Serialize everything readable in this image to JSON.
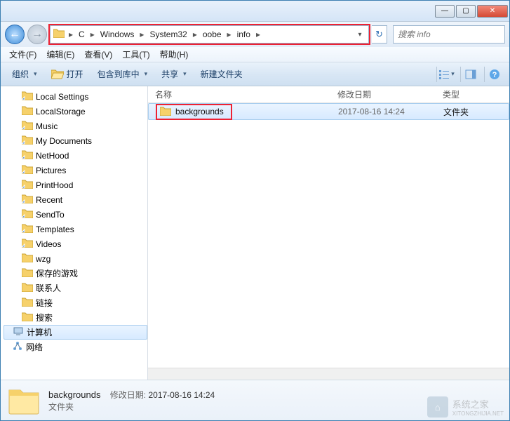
{
  "titlebar": {
    "min": "—",
    "max": "▢",
    "close": "✕"
  },
  "nav": {
    "back": "←",
    "forward": "→"
  },
  "breadcrumbs": [
    "C",
    "Windows",
    "System32",
    "oobe",
    "info"
  ],
  "refresh": "↻",
  "search": {
    "placeholder": "搜索 info"
  },
  "menu": {
    "file": "文件(F)",
    "edit": "编辑(E)",
    "view": "查看(V)",
    "tools": "工具(T)",
    "help": "帮助(H)"
  },
  "toolbar": {
    "organize": "组织",
    "open": "打开",
    "include": "包含到库中",
    "share": "共享",
    "newfolder": "新建文件夹"
  },
  "columns": {
    "name": "名称",
    "date": "修改日期",
    "type": "类型"
  },
  "tree": [
    {
      "label": "Local Settings",
      "icon": "folder-shortcut"
    },
    {
      "label": "LocalStorage",
      "icon": "folder"
    },
    {
      "label": "Music",
      "icon": "folder-shortcut"
    },
    {
      "label": "My Documents",
      "icon": "folder-shortcut"
    },
    {
      "label": "NetHood",
      "icon": "folder-shortcut"
    },
    {
      "label": "Pictures",
      "icon": "folder-shortcut"
    },
    {
      "label": "PrintHood",
      "icon": "folder-shortcut"
    },
    {
      "label": "Recent",
      "icon": "folder-shortcut"
    },
    {
      "label": "SendTo",
      "icon": "folder-shortcut"
    },
    {
      "label": "Templates",
      "icon": "folder-shortcut"
    },
    {
      "label": "Videos",
      "icon": "folder-shortcut"
    },
    {
      "label": "wzg",
      "icon": "folder"
    },
    {
      "label": "保存的游戏",
      "icon": "folder-games"
    },
    {
      "label": "联系人",
      "icon": "folder-contacts"
    },
    {
      "label": "链接",
      "icon": "folder-links"
    },
    {
      "label": "搜索",
      "icon": "folder-search"
    },
    {
      "label": "计算机",
      "icon": "computer",
      "selected": true,
      "indent": 12
    },
    {
      "label": "网络",
      "icon": "network",
      "indent": 12
    }
  ],
  "files": [
    {
      "name": "backgrounds",
      "date": "2017-08-16 14:24",
      "type": "文件夹",
      "selected": true,
      "highlighted": true
    }
  ],
  "details": {
    "name": "backgrounds",
    "date_label": "修改日期:",
    "date": "2017-08-16 14:24",
    "type": "文件夹"
  },
  "watermark": {
    "text": "系统之家",
    "sub": "XITONGZHIJIA.NET"
  }
}
